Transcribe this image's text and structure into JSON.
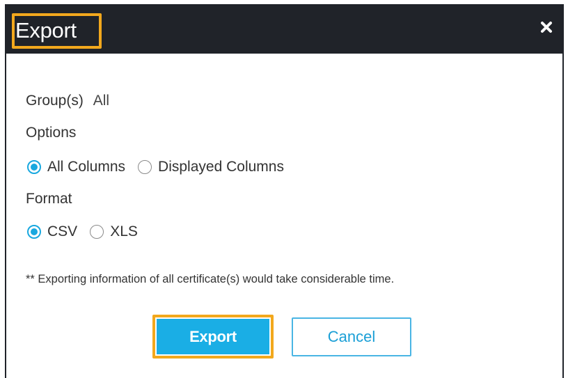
{
  "dialog": {
    "title": "Export",
    "close_icon": "close-icon"
  },
  "groups": {
    "label": "Group(s)",
    "value": "All"
  },
  "options": {
    "label": "Options",
    "choices": [
      {
        "label": "All Columns",
        "checked": true
      },
      {
        "label": "Displayed Columns",
        "checked": false
      }
    ]
  },
  "format": {
    "label": "Format",
    "choices": [
      {
        "label": "CSV",
        "checked": true
      },
      {
        "label": "XLS",
        "checked": false
      }
    ]
  },
  "note": "** Exporting information of all certificate(s) would take considerable time.",
  "buttons": {
    "export_label": "Export",
    "cancel_label": "Cancel"
  },
  "colors": {
    "titlebar": "#202329",
    "highlight": "#f2a81d",
    "accent": "#1aaee5"
  }
}
